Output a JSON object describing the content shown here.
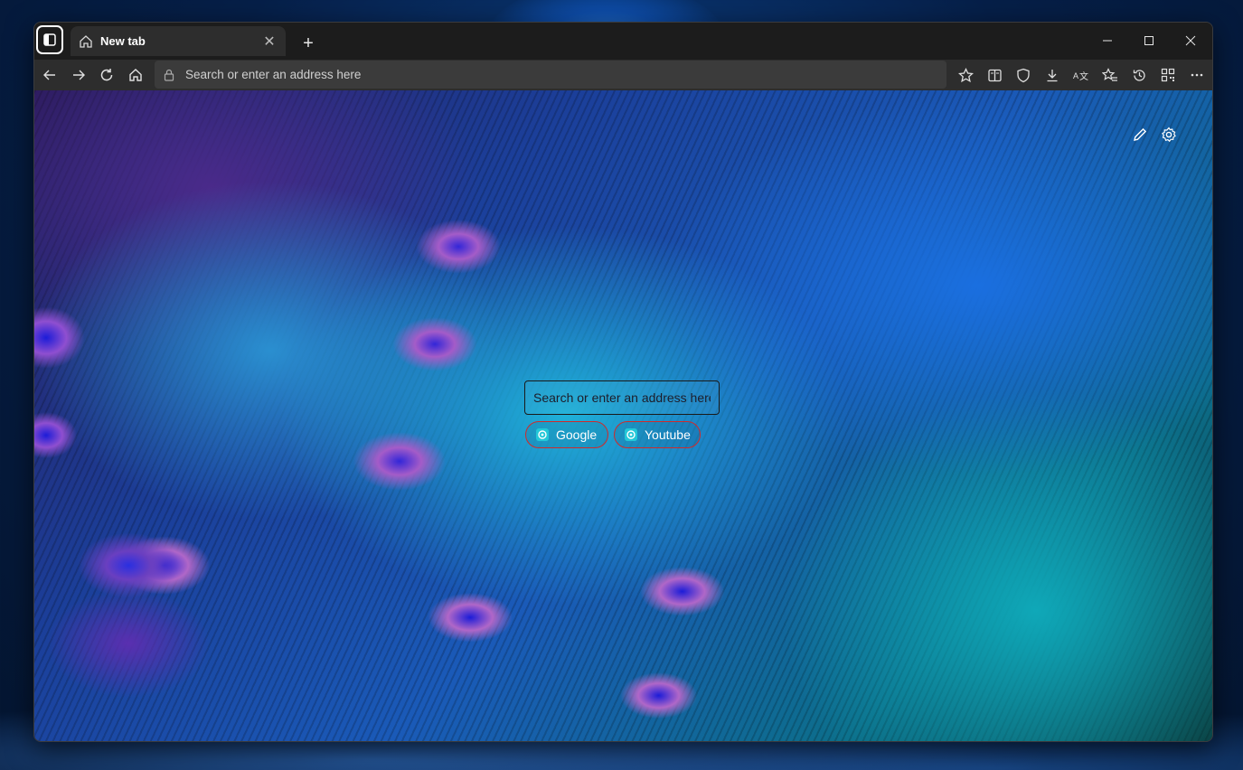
{
  "window": {
    "tab": {
      "title": "New tab",
      "close_glyph": "✕",
      "icon": "home-icon"
    },
    "new_tab_glyph": "+"
  },
  "window_controls": {
    "minimize": "minimize-icon",
    "maximize": "maximize-icon",
    "close": "close-icon"
  },
  "toolbar": {
    "address_placeholder": "Search or enter an address here",
    "icons": [
      "back-arrow-icon",
      "forward-arrow-icon",
      "refresh-icon",
      "home-icon",
      "star-icon",
      "reading-view-icon",
      "shield-icon",
      "download-icon",
      "translate-icon",
      "favorites-icon",
      "history-icon",
      "qr-code-icon",
      "more-icon"
    ]
  },
  "page": {
    "search_placeholder": "Search or enter an address here",
    "shortcuts": [
      {
        "label": "Google"
      },
      {
        "label": "Youtube"
      }
    ],
    "top_right_icons": [
      "edit-pencil-icon",
      "settings-gear-icon"
    ]
  },
  "colors": {
    "shortcut_border": "#d12a2a",
    "shortcut_icon": "#23c8d8",
    "chrome_bg": "#2d2d2d"
  }
}
